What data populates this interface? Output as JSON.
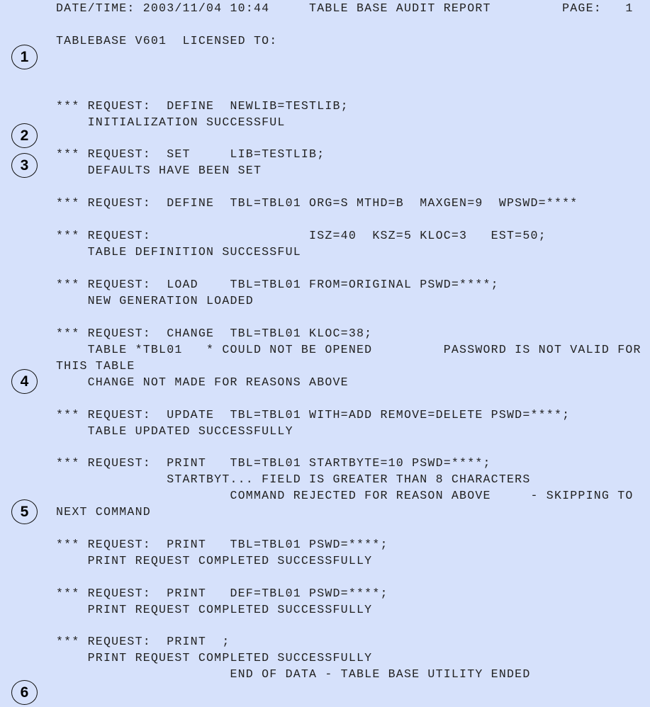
{
  "report": {
    "header": {
      "datetime_label": "DATE/TIME:",
      "datetime_value": "2003/11/04 10:44",
      "title": "TABLE BASE AUDIT REPORT",
      "page_label": "PAGE:",
      "page_number": "1",
      "full_line": "DATE/TIME: 2003/11/04 10:44     TABLE BASE AUDIT REPORT         PAGE:   1"
    },
    "license_line": "TABLEBASE V601  LICENSED TO:",
    "lines": [
      "*** REQUEST:  DEFINE  NEWLIB=TESTLIB;",
      "    INITIALIZATION SUCCESSFUL",
      "*** REQUEST:  SET     LIB=TESTLIB;",
      "    DEFAULTS HAVE BEEN SET",
      "*** REQUEST:  DEFINE  TBL=TBL01 ORG=S MTHD=B  MAXGEN=9  WPSWD=****",
      "*** REQUEST:                    ISZ=40  KSZ=5 KLOC=3   EST=50;",
      "    TABLE DEFINITION SUCCESSFUL",
      "*** REQUEST:  LOAD    TBL=TBL01 FROM=ORIGINAL PSWD=****;",
      "    NEW GENERATION LOADED",
      "*** REQUEST:  CHANGE  TBL=TBL01 KLOC=38;",
      "    TABLE *TBL01   * COULD NOT BE OPENED         PASSWORD IS NOT VALID FOR",
      "THIS TABLE",
      "    CHANGE NOT MADE FOR REASONS ABOVE",
      "*** REQUEST:  UPDATE  TBL=TBL01 WITH=ADD REMOVE=DELETE PSWD=****;",
      "    TABLE UPDATED SUCCESSFULLY",
      "*** REQUEST:  PRINT   TBL=TBL01 STARTBYTE=10 PSWD=****;",
      "              STARTBYT... FIELD IS GREATER THAN 8 CHARACTERS",
      "                      COMMAND REJECTED FOR REASON ABOVE     - SKIPPING TO",
      "NEXT COMMAND",
      "*** REQUEST:  PRINT   TBL=TBL01 PSWD=****;",
      "    PRINT REQUEST COMPLETED SUCCESSFULLY",
      "*** REQUEST:  PRINT   DEF=TBL01 PSWD=****;",
      "    PRINT REQUEST COMPLETED SUCCESSFULLY",
      "*** REQUEST:  PRINT  ;",
      "    PRINT REQUEST COMPLETED SUCCESSFULLY",
      "                      END OF DATA - TABLE BASE UTILITY ENDED"
    ]
  },
  "callouts": [
    "1",
    "2",
    "3",
    "4",
    "5",
    "6"
  ],
  "colors": {
    "background": "#d6e1fb",
    "text": "#222222",
    "callout_border": "#111111"
  }
}
